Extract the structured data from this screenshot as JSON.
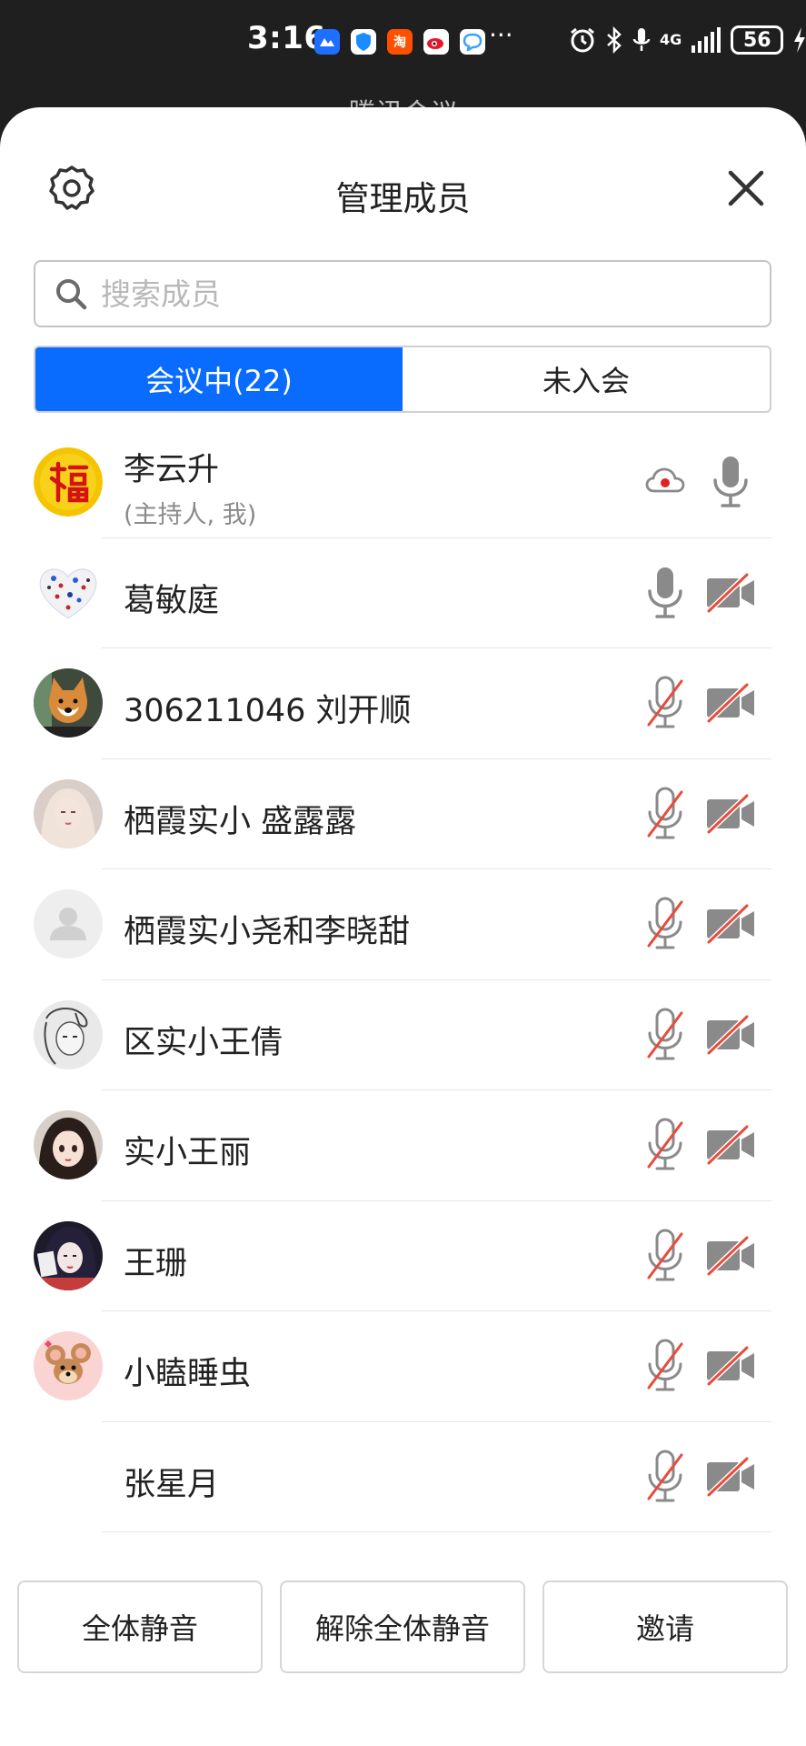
{
  "status_bar": {
    "time": "3:16",
    "dots": "···",
    "network": "4G",
    "battery": "56",
    "apps": [
      {
        "icon": "blue-app-icon",
        "color": "#1e6fff",
        "label": ""
      },
      {
        "icon": "shield-app-icon",
        "color": "#1a8cff",
        "label": ""
      },
      {
        "icon": "taobao-app-icon",
        "color": "#ff5000",
        "label": "淘"
      },
      {
        "icon": "weibo-app-icon",
        "color": "#e6162d",
        "label": ""
      },
      {
        "icon": "chat-app-icon",
        "color": "#3aa0ff",
        "label": ""
      }
    ]
  },
  "background_title": "腾讯会议",
  "header": {
    "title": "管理成员"
  },
  "search": {
    "placeholder": "搜索成员"
  },
  "tabs": [
    {
      "label": "会议中(22)",
      "active": true
    },
    {
      "label": "未入会",
      "active": false
    }
  ],
  "members": [
    {
      "name": "李云升",
      "sub": "(主持人, 我)",
      "avatar": "fu-avatar",
      "mic": "on",
      "cam": "none",
      "cloud_recording": true
    },
    {
      "name": "葛敏庭",
      "avatar": "heart-avatar",
      "mic": "on",
      "cam": "off"
    },
    {
      "name": "306211046 刘开顺",
      "avatar": "shiba-avatar",
      "mic": "muted",
      "cam": "off"
    },
    {
      "name": "栖霞实小 盛露露",
      "avatar": "girl-avatar",
      "mic": "muted",
      "cam": "off"
    },
    {
      "name": "栖霞实小尧和李晓甜",
      "avatar": "default-avatar",
      "mic": "muted",
      "cam": "off"
    },
    {
      "name": "区实小王倩",
      "avatar": "sketch-avatar",
      "mic": "muted",
      "cam": "off"
    },
    {
      "name": "实小王丽",
      "avatar": "anime-girl-avatar",
      "mic": "muted",
      "cam": "off"
    },
    {
      "name": "王珊",
      "avatar": "dark-hair-avatar",
      "mic": "muted",
      "cam": "off"
    },
    {
      "name": "小瞌睡虫",
      "avatar": "jerry-avatar",
      "mic": "muted",
      "cam": "off"
    },
    {
      "name": "张星月",
      "avatar": "none",
      "mic": "muted",
      "cam": "off"
    }
  ],
  "buttons": {
    "mute_all": "全体静音",
    "unmute_all": "解除全体静音",
    "invite": "邀请"
  },
  "colors": {
    "accent": "#0a6cff",
    "muted_red": "#e74c3c",
    "icon_gray": "#8a8a8a"
  }
}
